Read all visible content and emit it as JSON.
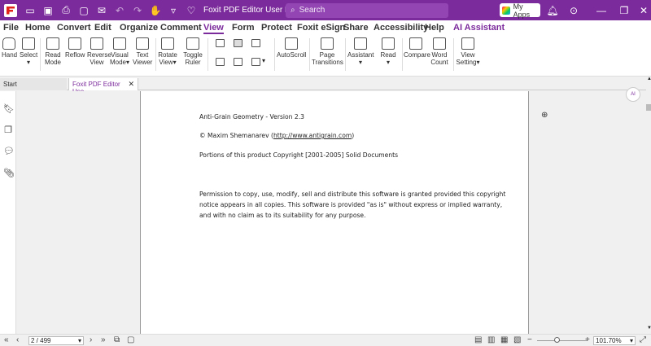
{
  "window": {
    "title": "Foxit PDF Editor User Manual",
    "search_placeholder": "Search",
    "my_apps_label": "My Apps"
  },
  "menu": [
    "File",
    "Home",
    "Convert",
    "Edit",
    "Organize",
    "Comment",
    "View",
    "Form",
    "Protect",
    "Foxit eSign",
    "Share",
    "Accessibility",
    "Help",
    "AI Assistant"
  ],
  "ribbon": {
    "hand": "Hand",
    "select": "Select",
    "read_mode": [
      "Read",
      "Mode"
    ],
    "reflow": "Reflow",
    "reverse_view": [
      "Reverse",
      "View"
    ],
    "visual_mode": [
      "Visual",
      "Mode"
    ],
    "text_viewer": [
      "Text",
      "Viewer"
    ],
    "rotate_view": [
      "Rotate",
      "View"
    ],
    "toggle_ruler": [
      "Toggle",
      "Ruler"
    ],
    "autoscroll": "AutoScroll",
    "page_transitions": [
      "Page",
      "Transitions"
    ],
    "assistant": "Assistant",
    "read": "Read",
    "compare": "Compare",
    "word_count": [
      "Word",
      "Count"
    ],
    "view_setting": [
      "View",
      "Setting"
    ]
  },
  "tabs": {
    "start": "Start",
    "doc": "Foxit PDF Editor Use..."
  },
  "document": {
    "line1": "Anti-Grain Geometry - Version 2.3",
    "line2_prefix": "© Maxim Shemanarev (",
    "line2_link": "http://www.antigrain.com",
    "line2_suffix": ")",
    "line3": "Portions of this product Copyright [2001-2005] Solid Documents",
    "para1": "Permission to copy, use, modify, sell and distribute this software is granted provided this copyright",
    "para2": "notice appears in all copies. This software is provided \"as is\" without express or implied warranty,",
    "para3": "and with no claim as to its suitability for any purpose."
  },
  "status": {
    "page": "2 / 499",
    "zoom": "101.70%",
    "zoom_fraction": 0.4
  },
  "colors": {
    "brand": "#7c2b9c"
  }
}
